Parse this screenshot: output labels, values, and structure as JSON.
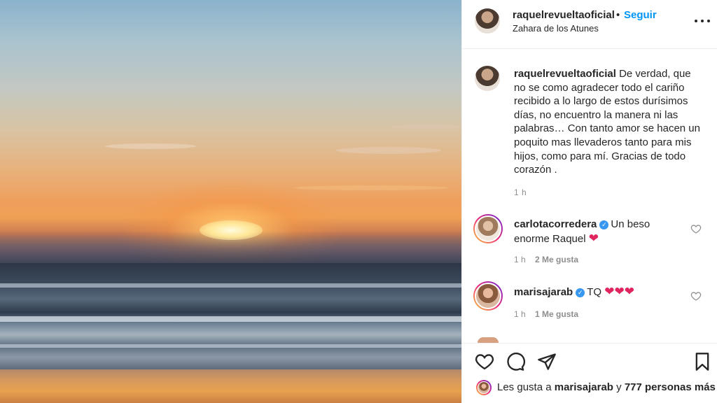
{
  "post": {
    "photo_alt": "",
    "header": {
      "username": "raquelrevueltaoficial",
      "separator": "•",
      "follow_label": "Seguir",
      "location": "Zahara de los Atunes"
    },
    "caption": {
      "username": "raquelrevueltaoficial",
      "text": "De verdad, que no se como agradecer todo el cariño recibido a lo largo de estos durísimos días, no encuentro la manera ni las palabras… Con tanto amor se hacen un poquito mas llevaderos tanto para mis hijos, como para mí. Gracias de todo corazón .",
      "time": "1 h"
    },
    "comments": [
      {
        "username": "carlotacorredera",
        "verified": true,
        "text": "Un beso enorme Raquel",
        "emoji": "❤",
        "time": "1 h",
        "likes": "2 Me gusta"
      },
      {
        "username": "marisajarab",
        "verified": true,
        "text": "TQ",
        "emoji": "❤❤❤",
        "time": "1 h",
        "likes": "1 Me gusta"
      }
    ],
    "likes_summary": {
      "prefix": "Les gusta a",
      "user": "marisajarab",
      "connector": "y",
      "others": "777 personas más"
    },
    "icons": {
      "like": "heart-outline-icon",
      "comment": "comment-bubble-icon",
      "share": "paper-plane-icon",
      "save": "bookmark-icon",
      "more": "more-options-icon",
      "verified": "verified-badge-icon"
    },
    "colors": {
      "link_blue": "#0095f6",
      "verified_blue": "#3897f0",
      "heart_red": "#e0245e",
      "muted": "#8e8e8e"
    }
  }
}
